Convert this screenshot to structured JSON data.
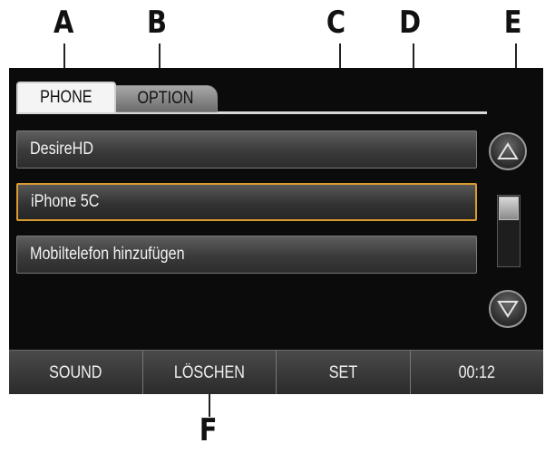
{
  "callouts": {
    "a": "A",
    "b": "B",
    "c": "C",
    "d": "D",
    "e": "E",
    "f": "F"
  },
  "tabs": {
    "phone": "PHONE",
    "option": "OPTION"
  },
  "list": {
    "items": [
      {
        "label": "DesireHD",
        "selected": false
      },
      {
        "label": "iPhone 5C",
        "selected": true
      },
      {
        "label": "Mobiltelefon hinzufügen",
        "selected": false
      }
    ]
  },
  "scroll": {
    "up_icon": "triangle-up-icon",
    "down_icon": "triangle-down-icon"
  },
  "bottom_bar": {
    "sound": "SOUND",
    "delete": "LÖSCHEN",
    "set": "SET",
    "time": "00:12"
  },
  "colors": {
    "selection_border": "#d99a2f",
    "screen_bg": "#0b0b0b"
  }
}
